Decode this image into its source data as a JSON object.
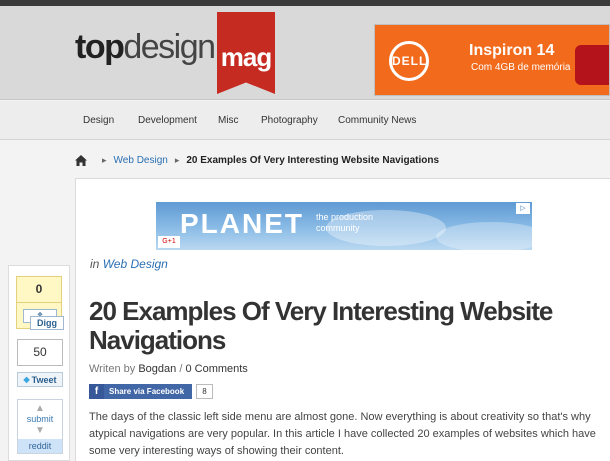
{
  "header": {
    "logo": {
      "part1": "top",
      "part2": "design",
      "ribbon": "mag"
    },
    "ad": {
      "brand": "DELL",
      "title": "Inspiron 14",
      "subtitle": "Com 4GB de memória"
    }
  },
  "nav": {
    "items": [
      "Design",
      "Development",
      "Misc",
      "Photography",
      "Community News"
    ]
  },
  "breadcrumb": {
    "category": "Web Design",
    "current": "20 Examples Of Very Interesting Website Navigations"
  },
  "ad_banner": {
    "brand": "PLANET",
    "tagline_line1": "the production",
    "tagline_line2": "community",
    "gplus": "G+1",
    "adchoices": "▷"
  },
  "post": {
    "category_prefix": "in",
    "category": "Web Design",
    "title": "20 Examples Of Very Interesting Website Navigations",
    "byline_prefix": "Writen by",
    "author": "Bogdan",
    "byline_sep": "/",
    "comments": "0 Comments",
    "fb_share_label": "Share via Facebook",
    "fb_count": "8",
    "intro": "The days of the classic left side menu are almost gone. Now everything is about creativity so that's why atypical navigations are very popular. In this article I have collected 20 examples of websites which have some very interesting ways of showing their content."
  },
  "share": {
    "digg_count": "0",
    "digg_label": "Digg",
    "tweet_count": "50",
    "tweet_label": "Tweet",
    "reddit_submit": "submit",
    "reddit_label": "reddit"
  },
  "colors": {
    "accent": "#c62b21",
    "link": "#2a6fb3",
    "dell_orange": "#f26b1d",
    "facebook": "#4267a7"
  }
}
